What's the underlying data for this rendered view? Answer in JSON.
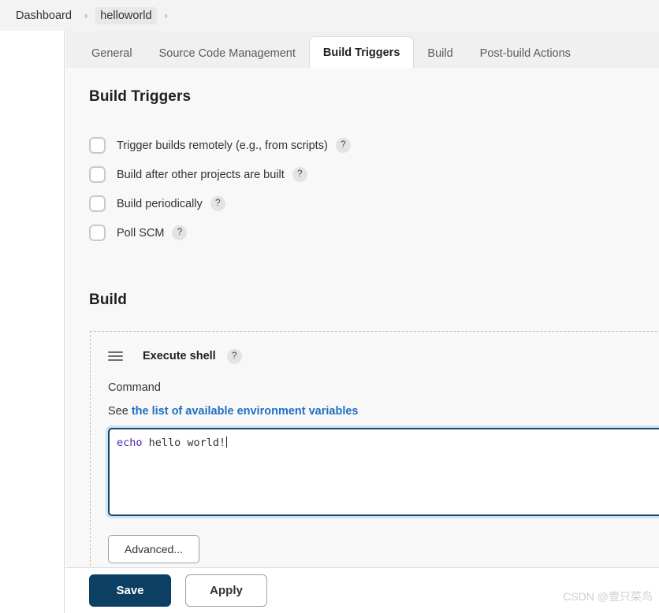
{
  "breadcrumb": {
    "items": [
      {
        "label": "Dashboard",
        "highlight": false
      },
      {
        "label": "helloworld",
        "highlight": true
      }
    ],
    "separator": "›"
  },
  "tabs": [
    {
      "label": "General",
      "active": false
    },
    {
      "label": "Source Code Management",
      "active": false
    },
    {
      "label": "Build Triggers",
      "active": true
    },
    {
      "label": "Build",
      "active": false
    },
    {
      "label": "Post-build Actions",
      "active": false
    }
  ],
  "build_triggers": {
    "heading": "Build Triggers",
    "help_glyph": "?",
    "options": [
      {
        "label": "Trigger builds remotely (e.g., from scripts)",
        "checked": false
      },
      {
        "label": "Build after other projects are built",
        "checked": false
      },
      {
        "label": "Build periodically",
        "checked": false
      },
      {
        "label": "Poll SCM",
        "checked": false
      }
    ]
  },
  "build": {
    "heading": "Build",
    "step": {
      "title": "Execute shell",
      "help_glyph": "?",
      "command_label": "Command",
      "env_prefix": "See",
      "env_link": "the list of available environment variables",
      "command_keyword": "echo",
      "command_rest": " hello world!",
      "advanced_label": "Advanced..."
    }
  },
  "footer": {
    "save_label": "Save",
    "apply_label": "Apply"
  },
  "watermark": "CSDN @壹只菜鸟",
  "colors": {
    "accent_primary": "#0b3f63",
    "link": "#1f6fc4",
    "keyword": "#4b27a8",
    "focus_border": "#11496b",
    "focus_glow": "#cfe2ef"
  }
}
